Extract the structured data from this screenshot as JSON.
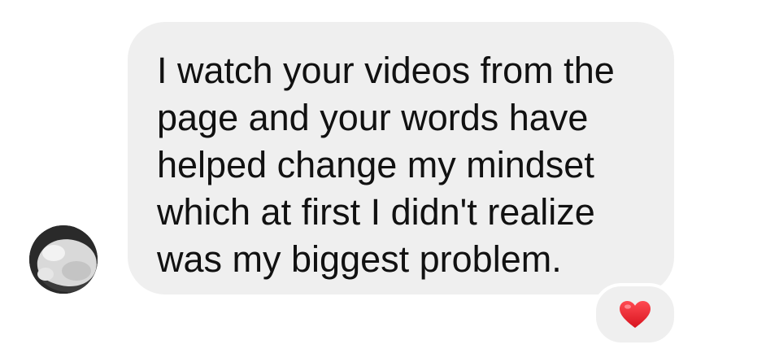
{
  "message": {
    "text": "I watch your videos from the\npage and your words have\nhelped change my mindset\nwhich at first I didn't realize\nwas my biggest problem.",
    "bubble_color": "#efefef",
    "text_color": "#111111"
  },
  "sender": {
    "avatar_icon": "blurred-profile-avatar"
  },
  "reaction": {
    "icon": "heart-icon",
    "color": "#e8232f"
  }
}
